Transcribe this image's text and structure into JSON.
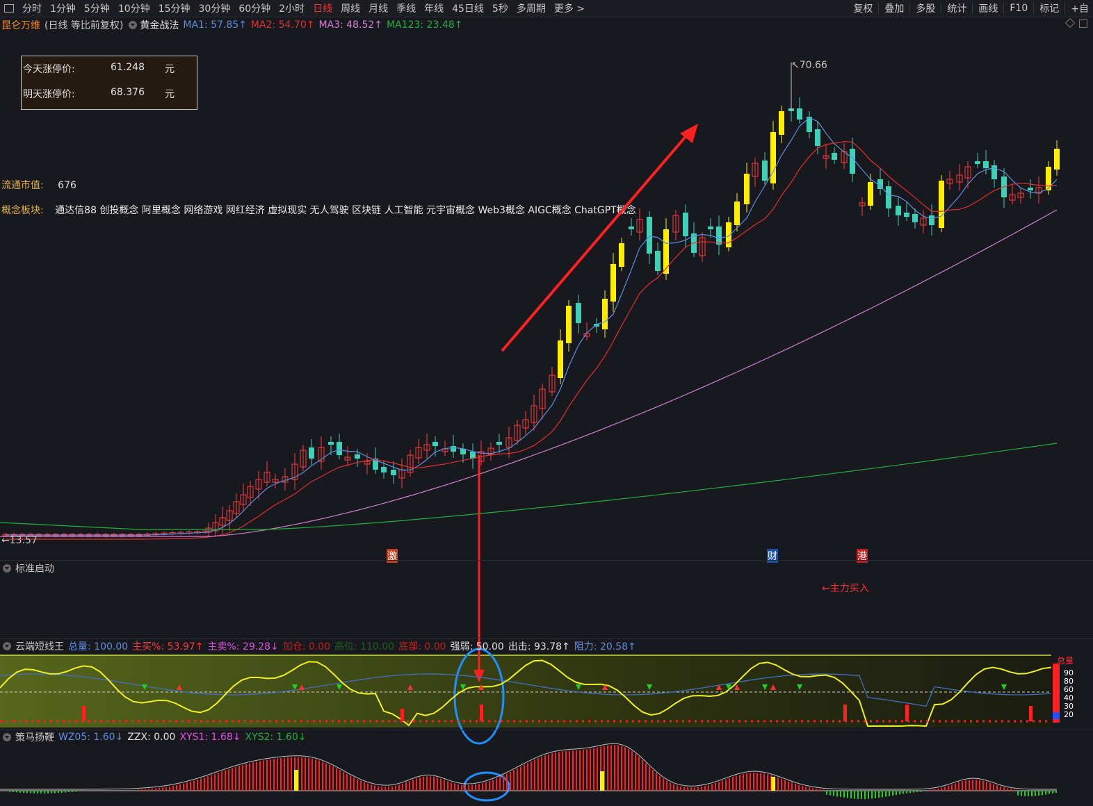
{
  "toolbar": {
    "periods": [
      "分时",
      "1分钟",
      "5分钟",
      "10分钟",
      "15分钟",
      "30分钟",
      "60分钟",
      "2小时",
      "日线",
      "周线",
      "月线",
      "季线",
      "年线",
      "45日线",
      "5秒",
      "多周期",
      "更多 >"
    ],
    "active_period": "日线",
    "right_items": [
      "复权",
      "叠加",
      "多股",
      "统计",
      "画线",
      "F10",
      "标记",
      "+自"
    ]
  },
  "info": {
    "stock_name": "昆仑万维",
    "chart_mode": "(日线 等比前复权)",
    "indicator_name": "黄金战法",
    "ma1": "MA1: 57.85↑",
    "ma2": "MA2: 54.70↑",
    "ma3": "MA3: 48.52↑",
    "ma123": "MA123: 23.48↑"
  },
  "price_box": {
    "today_label": "今天涨停价:",
    "today_value": "61.248",
    "today_unit": "元",
    "tomorrow_label": "明天涨停价:",
    "tomorrow_value": "68.376",
    "tomorrow_unit": "元"
  },
  "market_cap": {
    "label": "流通市值:",
    "value": "676"
  },
  "concepts": {
    "label": "概念板块:",
    "value": "通达信88 创投概念 阿里概念 网络游戏 网红经济 虚拟现实 无人驾驶 区块链 人工智能 元宇宙概念 Web3概念 AIGC概念 ChatGPT概念"
  },
  "annotations": {
    "high_price": "70.66",
    "low_price": "13.57",
    "marker_1": "激",
    "marker_2": "财",
    "marker_3": "港",
    "main_buy": "←主力买入"
  },
  "panel1": {
    "title": "标准启动"
  },
  "panel2": {
    "title": "云端短线王",
    "total": "总量: 100.00",
    "main_buy_pct": "主买%: 53.97↑",
    "main_sell_pct": "主卖%: 29.28↓",
    "add_pos": "加仓: 0.00",
    "high_pos": "高位: 110.00",
    "bottom": "底部: 0.00",
    "strength": "强弱: 50.00",
    "exit": "出击: 93.78↑",
    "resistance": "阻力: 20.58↑",
    "scale": [
      "90",
      "80",
      "60",
      "40",
      "30",
      "20"
    ],
    "scale_tag": "总量"
  },
  "panel3": {
    "title": "策马扬鞭",
    "wz05": "WZ05: 1.60↓",
    "zzx": "ZZX: 0.00",
    "xys1": "XYS1: 1.68↓",
    "xys2": "XYS2: 1.60↓"
  },
  "colors": {
    "up": "#ff3a3a",
    "down": "#3fd0b8",
    "highlight": "#ffee00",
    "ma1": "#5b8fe0",
    "ma2": "#e03030",
    "ma3": "#d080d0",
    "ma123": "#20b040",
    "panel2_bg": "#4a5a14"
  },
  "chart_data": {
    "type": "candlestick",
    "y_range": [
      13.57,
      70.66
    ],
    "note_high": 70.66,
    "note_low": 13.57
  }
}
